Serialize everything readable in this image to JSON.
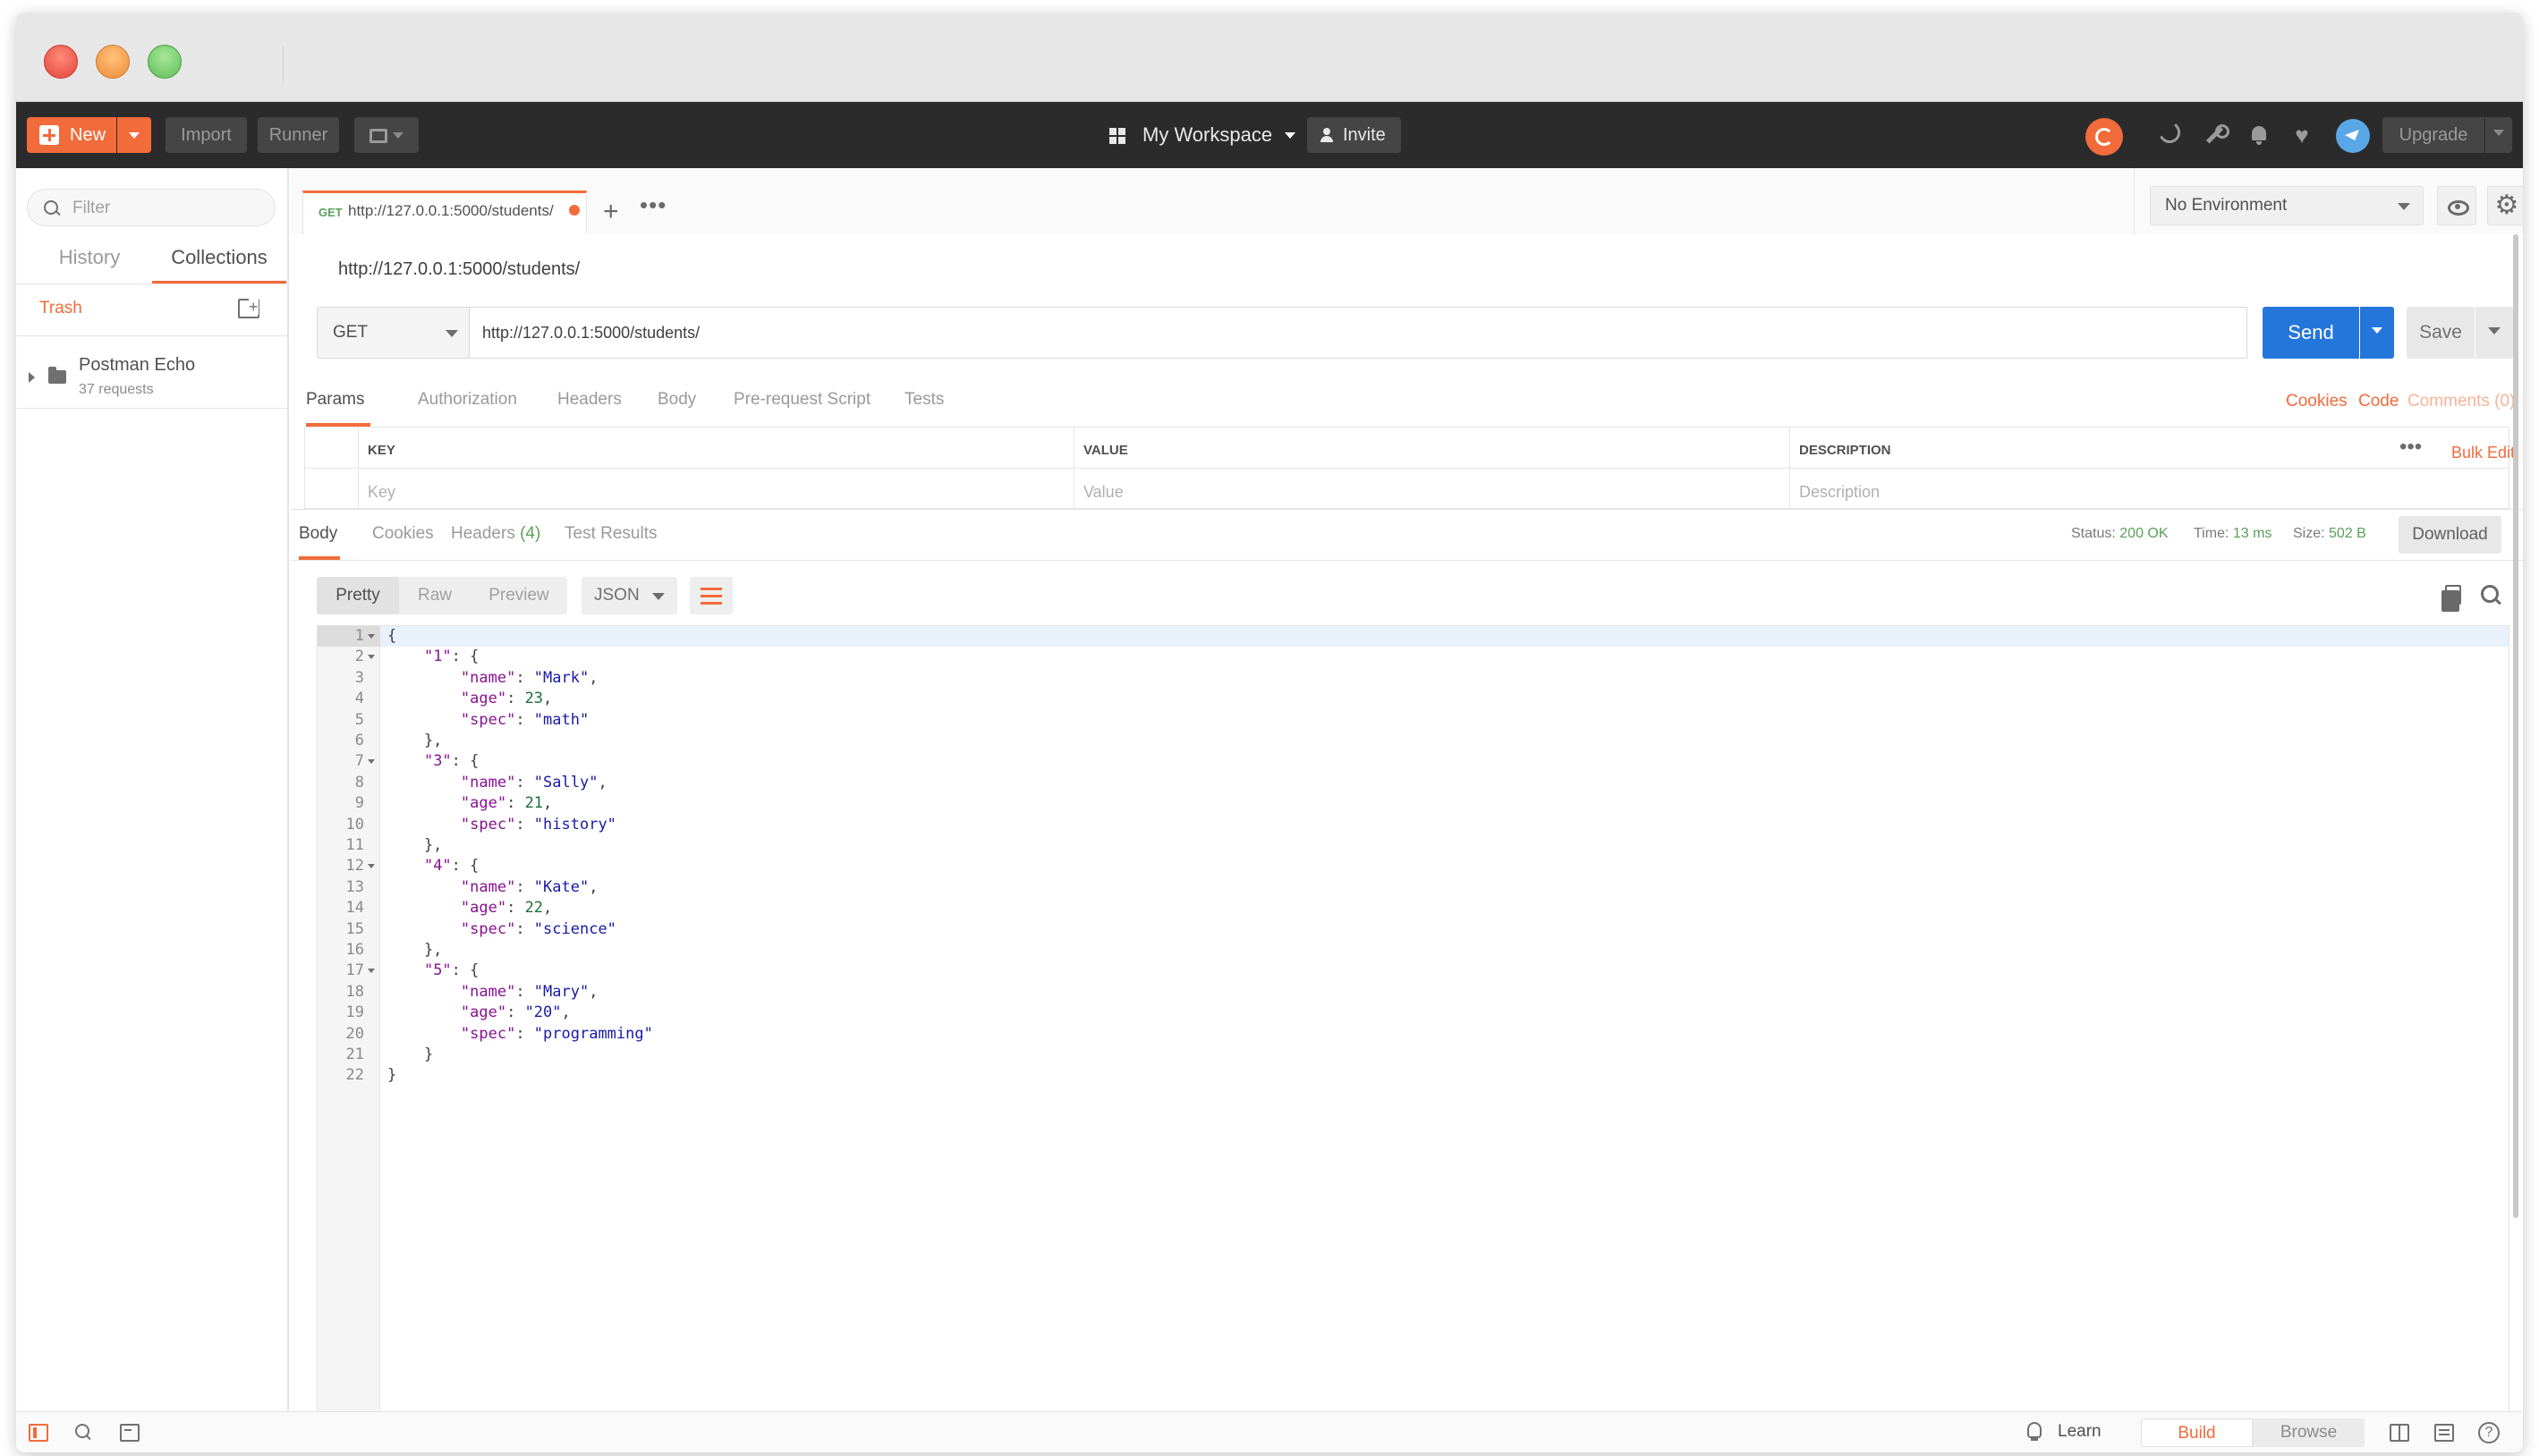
{
  "header": {
    "new_label": "New",
    "import_label": "Import",
    "runner_label": "Runner",
    "workspace_label": "My Workspace",
    "invite_label": "Invite",
    "upgrade_label": "Upgrade"
  },
  "sidebar": {
    "filter_placeholder": "Filter",
    "tabs": [
      {
        "label": "History",
        "active": false
      },
      {
        "label": "Collections",
        "active": true
      }
    ],
    "trash_label": "Trash",
    "collections": [
      {
        "name": "Postman Echo",
        "count": "37 requests"
      }
    ]
  },
  "request_tab": {
    "method": "GET",
    "url": "http://127.0.0.1:5000/students/",
    "unsaved": true
  },
  "environment": {
    "selected": "No Environment"
  },
  "request": {
    "name": "http://127.0.0.1:5000/students/",
    "method": "GET",
    "url": "http://127.0.0.1:5000/students/",
    "send_label": "Send",
    "save_label": "Save",
    "tabs": [
      "Params",
      "Authorization",
      "Headers",
      "Body",
      "Pre-request Script",
      "Tests"
    ],
    "active_tab": "Params",
    "links": {
      "cookies": "Cookies",
      "code": "Code",
      "comments": "Comments (0)"
    },
    "params_table": {
      "headers": [
        "KEY",
        "VALUE",
        "DESCRIPTION"
      ],
      "placeholders": [
        "Key",
        "Value",
        "Description"
      ],
      "bulk_edit_label": "Bulk Edit"
    }
  },
  "response": {
    "tabs": [
      "Body",
      "Cookies",
      "Headers",
      "Test Results"
    ],
    "headers_count": "(4)",
    "active_tab": "Body",
    "status_label": "Status:",
    "status_value": "200 OK",
    "time_label": "Time:",
    "time_value": "13 ms",
    "size_label": "Size:",
    "size_value": "502 B",
    "download_label": "Download",
    "formats": [
      "Pretty",
      "Raw",
      "Preview"
    ],
    "active_format": "Pretty",
    "language": "JSON",
    "body_lines": [
      "{",
      "    \"1\": {",
      "        \"name\": \"Mark\",",
      "        \"age\": 23,",
      "        \"spec\": \"math\"",
      "    },",
      "    \"3\": {",
      "        \"name\": \"Sally\",",
      "        \"age\": 21,",
      "        \"spec\": \"history\"",
      "    },",
      "    \"4\": {",
      "        \"name\": \"Kate\",",
      "        \"age\": 22,",
      "        \"spec\": \"science\"",
      "    },",
      "    \"5\": {",
      "        \"name\": \"Mary\",",
      "        \"age\": \"20\",",
      "        \"spec\": \"programming\"",
      "    }",
      "}"
    ],
    "fold_lines": [
      1,
      2,
      7,
      12,
      17
    ]
  },
  "statusbar": {
    "learn_label": "Learn",
    "modes": [
      "Build",
      "Browse"
    ],
    "active_mode": "Build"
  },
  "colors": {
    "accent": "#f26b3a",
    "send": "#2576db",
    "status_ok": "#5aa05a",
    "json_key": "#881391",
    "json_string": "#1a1aa6",
    "json_number": "#1c6e3a"
  }
}
